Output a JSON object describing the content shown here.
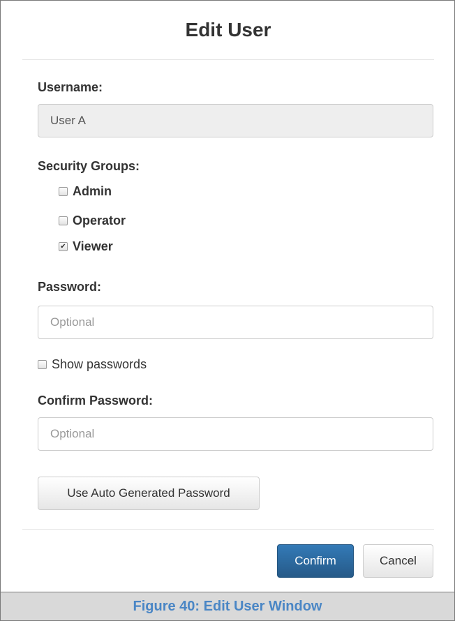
{
  "dialog": {
    "title": "Edit User",
    "username": {
      "label": "Username:",
      "value": "User A"
    },
    "security_groups": {
      "label": "Security Groups:",
      "options": [
        {
          "label": "Admin",
          "checked": false
        },
        {
          "label": "Operator",
          "checked": false
        },
        {
          "label": "Viewer",
          "checked": true
        }
      ]
    },
    "password": {
      "label": "Password:",
      "placeholder": "Optional"
    },
    "show_passwords": {
      "label": "Show passwords",
      "checked": false
    },
    "confirm_password": {
      "label": "Confirm Password:",
      "placeholder": "Optional"
    },
    "auto_password_button": "Use Auto Generated Password",
    "confirm_button": "Confirm",
    "cancel_button": "Cancel"
  },
  "caption": "Figure 40: Edit User Window",
  "colors": {
    "primary": "#337ab7",
    "caption_text": "#4a86c5",
    "caption_bg": "#d9d9d9"
  }
}
